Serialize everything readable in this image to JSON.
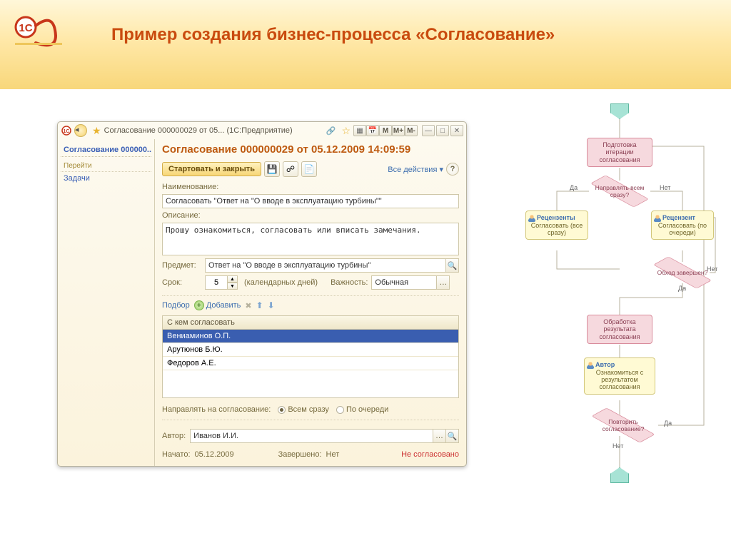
{
  "slide_title": "Пример создания бизнес-процесса «Согласование»",
  "window": {
    "titlebar": "Согласование 000000029 от 05...  (1С:Предприятие)",
    "mem": {
      "m": "M",
      "m_plus": "M+",
      "m_minus": "M-"
    }
  },
  "sidebar": {
    "title": "Согласование 000000...",
    "section": "Перейти",
    "items": [
      "Задачи"
    ]
  },
  "form": {
    "title": "Согласование 000000029 от 05.12.2009 14:09:59",
    "start_btn": "Стартовать и закрыть",
    "all_actions": "Все действия ▾",
    "labels": {
      "name": "Наименование:",
      "desc": "Описание:",
      "subject": "Предмет:",
      "term": "Срок:",
      "term_suffix": "(календарных дней)",
      "priority": "Важность:",
      "pick": "Подбор",
      "add": "Добавить",
      "approvers_header": "С кем согласовать",
      "send_mode": "Направлять на согласование:",
      "all_at_once": "Всем сразу",
      "in_turn": "По очереди",
      "author": "Автор:",
      "started": "Начато:",
      "finished": "Завершено:"
    },
    "values": {
      "name": "Согласовать \"Ответ на \"О вводе в эксплуатацию турбины\"\"",
      "desc": "Прошу ознакомиться, согласовать или вписать замечания.",
      "subject": "Ответ на \"О вводе в эксплуатацию турбины\"",
      "term": "5",
      "priority": "Обычная",
      "author": "Иванов И.И.",
      "started": "05.12.2009",
      "finished": "Нет",
      "status": "Не согласовано"
    },
    "approvers": [
      "Вениаминов О.П.",
      "Арутюнов Б.Ю.",
      "Федоров А.Е."
    ]
  },
  "diagram": {
    "prep": "Подготовка итерации согласования",
    "route_all": "Направлять всем сразу?",
    "reviewers": "Рецензенты",
    "reviewer": "Рецензент",
    "approve_all": "Согласовать (все сразу)",
    "approve_turn": "Согласовать (по очереди)",
    "cycle_done": "Обход завершен?",
    "process_result": "Обработка результата согласования",
    "author": "Автор",
    "review_result": "Ознакомиться с результатом согласования",
    "repeat": "Повторить согласование?",
    "yes": "Да",
    "no": "Нет"
  }
}
